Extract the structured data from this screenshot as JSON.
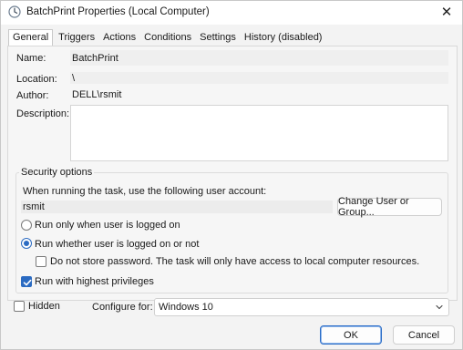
{
  "window": {
    "title": "BatchPrint Properties (Local Computer)",
    "close_glyph": "✕"
  },
  "tabs": [
    {
      "label": "General"
    },
    {
      "label": "Triggers"
    },
    {
      "label": "Actions"
    },
    {
      "label": "Conditions"
    },
    {
      "label": "Settings"
    },
    {
      "label": "History (disabled)"
    }
  ],
  "general": {
    "name_label": "Name:",
    "name_value": "BatchPrint",
    "location_label": "Location:",
    "location_value": "\\",
    "author_label": "Author:",
    "author_value": "DELL\\rsmit",
    "description_label": "Description:",
    "description_value": ""
  },
  "security": {
    "group_title": "Security options",
    "account_prompt": "When running the task, use the following user account:",
    "user_account": "rsmit",
    "change_user_button": "Change User or Group...",
    "radio_logged_on": "Run only when user is logged on",
    "radio_whether": "Run whether user is logged on or not",
    "radio_selected": "whether",
    "do_not_store_password": "Do not store password.  The task will only have access to local computer resources.",
    "do_not_store_password_checked": false,
    "highest_privileges": "Run with highest privileges",
    "highest_privileges_checked": true
  },
  "footer": {
    "hidden_label": "Hidden",
    "hidden_checked": false,
    "configure_for_label": "Configure for:",
    "configure_for_value": "Windows 10",
    "ok_button": "OK",
    "cancel_button": "Cancel"
  },
  "colors": {
    "accent": "#2b6bc2"
  }
}
